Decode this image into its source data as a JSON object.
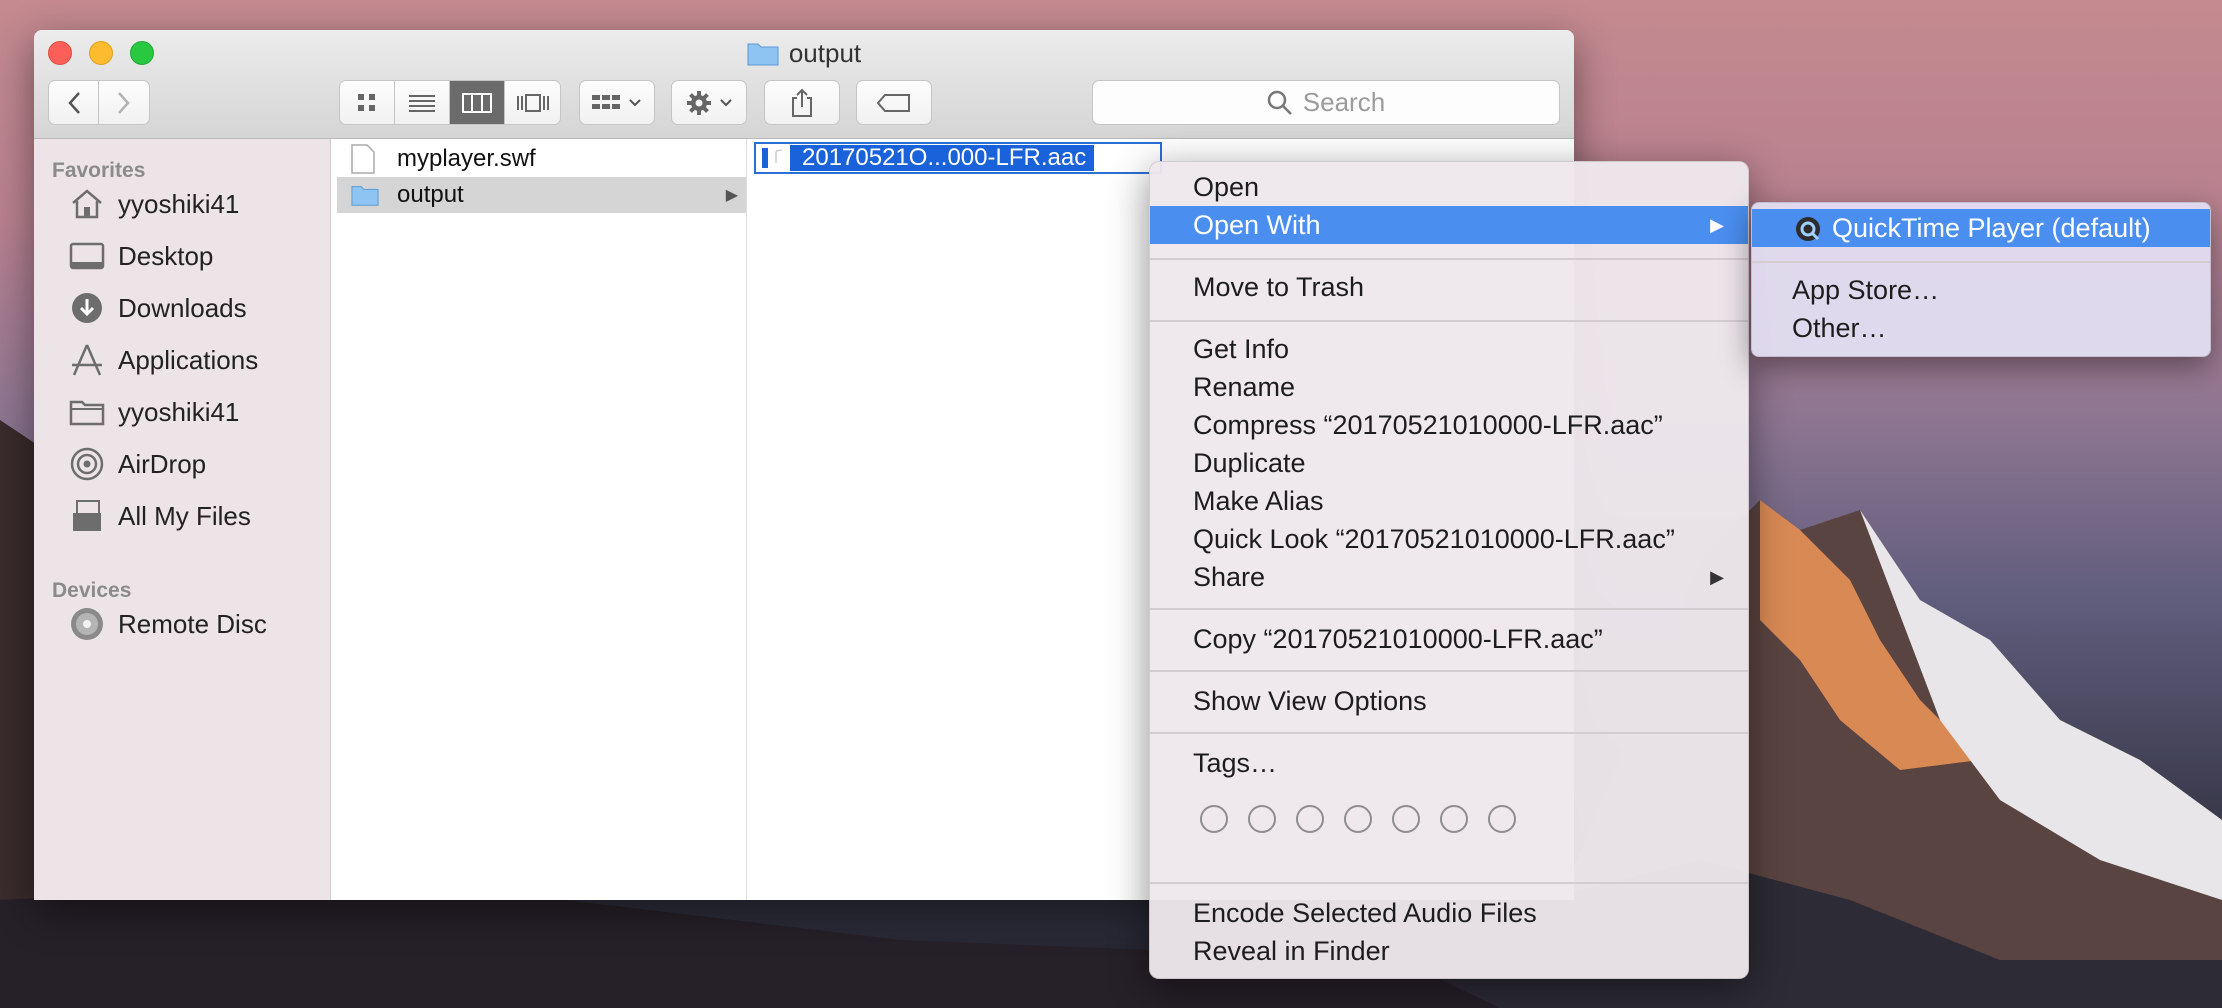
{
  "window": {
    "title": "output",
    "toolbar": {
      "back": "back",
      "forward": "forward",
      "search_placeholder": "Search"
    }
  },
  "sidebar": {
    "favorites_header": "Favorites",
    "favorites": [
      {
        "label": "yyoshiki41",
        "icon": "home-icon"
      },
      {
        "label": "Desktop",
        "icon": "desktop-icon"
      },
      {
        "label": "Downloads",
        "icon": "downloads-icon"
      },
      {
        "label": "Applications",
        "icon": "applications-icon"
      },
      {
        "label": "yyoshiki41",
        "icon": "folder-icon"
      },
      {
        "label": "AirDrop",
        "icon": "airdrop-icon"
      },
      {
        "label": "All My Files",
        "icon": "all-files-icon"
      }
    ],
    "devices_header": "Devices",
    "devices": [
      {
        "label": "Remote Disc",
        "icon": "disc-icon"
      }
    ]
  },
  "columns": {
    "col1": [
      {
        "name": "myplayer.swf",
        "type": "file"
      },
      {
        "name": "output",
        "type": "folder",
        "selected": true
      }
    ],
    "col2_selected_file": "20170521О...000-LFR.aac"
  },
  "context_menu": {
    "open": "Open",
    "open_with": "Open With",
    "move_to_trash": "Move to Trash",
    "get_info": "Get Info",
    "rename": "Rename",
    "compress": "Compress “20170521010000-LFR.aac”",
    "duplicate": "Duplicate",
    "make_alias": "Make Alias",
    "quick_look": "Quick Look “20170521010000-LFR.aac”",
    "share": "Share",
    "copy": "Copy “20170521010000-LFR.aac”",
    "show_view_options": "Show View Options",
    "tags": "Tags…",
    "encode_audio": "Encode Selected Audio Files",
    "reveal_in_finder": "Reveal in Finder"
  },
  "submenu": {
    "quicktime": "QuickTime Player (default)",
    "app_store": "App Store…",
    "other": "Other…"
  },
  "colors": {
    "highlight": "#4a8ef0",
    "selection": "#1a62d9"
  }
}
